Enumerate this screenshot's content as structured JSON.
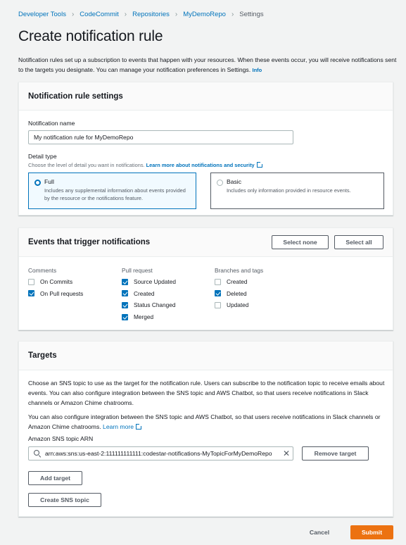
{
  "breadcrumb": {
    "items": [
      "Developer Tools",
      "CodeCommit",
      "Repositories",
      "MyDemoRepo"
    ],
    "current": "Settings",
    "separator": ">"
  },
  "page": {
    "title": "Create notification rule",
    "intro": "Notification rules set up a subscription to events that happen with your resources. When these events occur, you will receive notifications sent to the targets you designate. You can manage your notification preferences in Settings.",
    "info_link": "Info"
  },
  "settings_panel": {
    "title": "Notification rule settings",
    "name_label": "Notification name",
    "name_value": "My notification rule for MyDemoRepo",
    "detail_type_label": "Detail type",
    "detail_type_desc": "Choose the level of detail you want in notifications.",
    "detail_type_link": "Learn more about notifications and security",
    "options": [
      {
        "title": "Full",
        "desc": "Includes any supplemental information about events provided by the resource or the notifications feature.",
        "selected": true
      },
      {
        "title": "Basic",
        "desc": "Includes only information provided in resource events.",
        "selected": false
      }
    ]
  },
  "events_panel": {
    "title": "Events that trigger notifications",
    "select_none": "Select none",
    "select_all": "Select all",
    "groups": [
      {
        "title": "Comments",
        "items": [
          {
            "label": "On Commits",
            "checked": false
          },
          {
            "label": "On Pull requests",
            "checked": true
          }
        ]
      },
      {
        "title": "Pull request",
        "items": [
          {
            "label": "Source Updated",
            "checked": true
          },
          {
            "label": "Created",
            "checked": true
          },
          {
            "label": "Status Changed",
            "checked": true
          },
          {
            "label": "Merged",
            "checked": true
          }
        ]
      },
      {
        "title": "Branches and tags",
        "items": [
          {
            "label": "Created",
            "checked": false
          },
          {
            "label": "Deleted",
            "checked": true
          },
          {
            "label": "Updated",
            "checked": false
          }
        ]
      }
    ]
  },
  "targets_panel": {
    "title": "Targets",
    "para1": "Choose an SNS topic to use as the target for the notification rule. Users can subscribe to the notification topic to receive emails about events. You can also configure integration between the SNS topic and AWS Chatbot, so that users receive notifications in Slack channels or Amazon Chime chatrooms.",
    "para2": "You can also configure integration between the SNS topic and AWS Chatbot, so that users receive notifications in Slack channels or Amazon Chime chatrooms.",
    "learn_more": "Learn more",
    "arn_label": "Amazon SNS topic ARN",
    "arn_value": "arn:aws:sns:us-east-2:111111111111:codestar-notifications-MyTopicForMyDemoRepo",
    "remove_target": "Remove target",
    "add_target": "Add target",
    "create_topic": "Create SNS topic"
  },
  "footer": {
    "cancel": "Cancel",
    "submit": "Submit"
  },
  "colors": {
    "accent": "#0073bb",
    "primary_button": "#ec7211",
    "background": "#f2f3f3"
  }
}
